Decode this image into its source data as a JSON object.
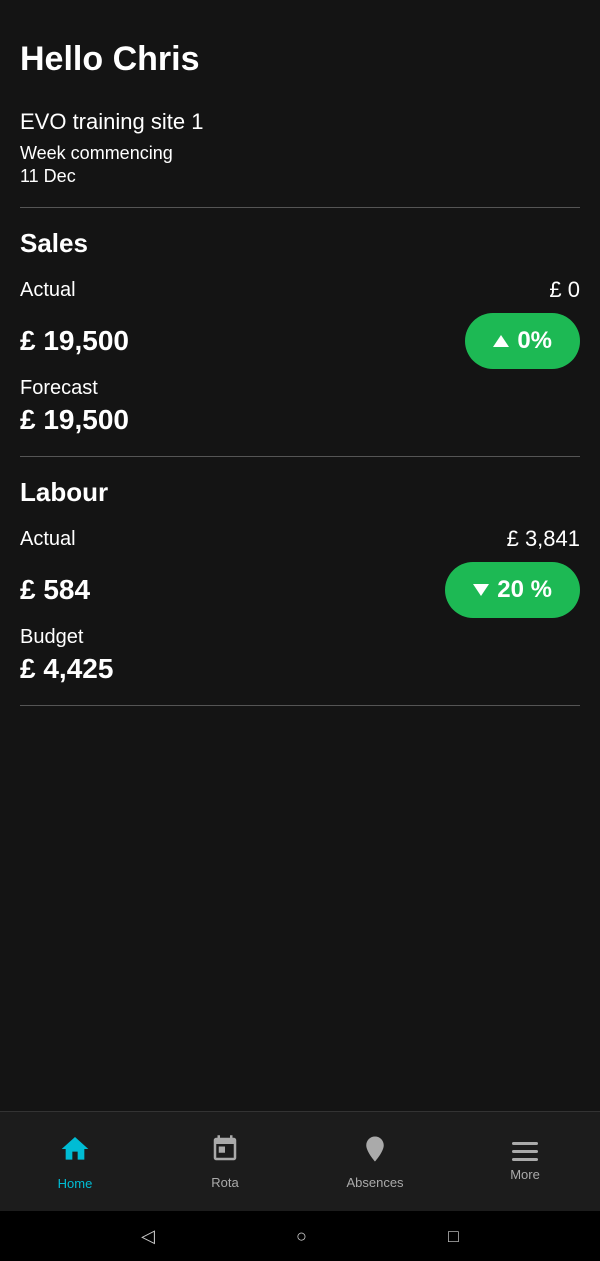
{
  "header": {
    "greeting": "Hello Chris"
  },
  "site": {
    "name": "EVO training site 1",
    "week_label": "Week commencing",
    "week_date": "11 Dec"
  },
  "sales": {
    "section_title": "Sales",
    "actual_label": "Actual",
    "actual_value": "£ 0",
    "amount_large": "£ 19,500",
    "percent_badge": "0%",
    "forecast_label": "Forecast",
    "forecast_amount": "£ 19,500"
  },
  "labour": {
    "section_title": "Labour",
    "actual_label": "Actual",
    "actual_value": "£ 3,841",
    "amount_large": "£ 584",
    "percent_badge": "20 %",
    "budget_label": "Budget",
    "budget_amount": "£ 4,425"
  },
  "bottom_nav": {
    "home_label": "Home",
    "rota_label": "Rota",
    "absences_label": "Absences",
    "more_label": "More"
  },
  "android_nav": {
    "back": "◁",
    "home": "○",
    "recent": "□"
  },
  "colors": {
    "active_nav": "#00bcd4",
    "badge_green": "#1db954",
    "background": "#141414",
    "nav_bg": "#1c1c1c"
  }
}
